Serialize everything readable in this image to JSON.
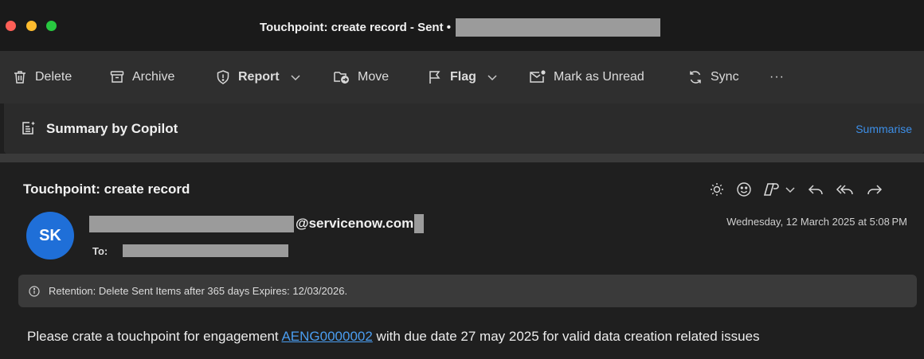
{
  "window": {
    "title": "Touchpoint: create record - Sent •"
  },
  "toolbar": {
    "delete": "Delete",
    "archive": "Archive",
    "report": "Report",
    "move": "Move",
    "flag": "Flag",
    "mark_unread": "Mark as Unread",
    "sync": "Sync",
    "more": "···"
  },
  "copilot": {
    "title": "Summary by Copilot",
    "summarise": "Summarise"
  },
  "message": {
    "subject": "Touchpoint: create record",
    "avatar_initials": "SK",
    "sender_domain": "@servicenow.com",
    "to_label": "To:",
    "date": "Wednesday, 12 March 2025 at 5:08 PM",
    "retention": "Retention: Delete Sent Items after 365 days Expires: 12/03/2026.",
    "body_before": "Please crate a touchpoint for engagement ",
    "body_link": "AENG0000002",
    "body_after": " with due date 27 may 2025 for valid data creation related issues"
  },
  "icons": {
    "delete": "trash-icon",
    "archive": "archive-box-icon",
    "report": "shield-icon",
    "move": "move-folder-icon",
    "flag": "flag-icon",
    "mark_unread": "envelope-dot-icon",
    "sync": "sync-icon",
    "copilot": "copilot-summary-icon",
    "actions": [
      "sun-icon",
      "emoji-icon",
      "loop-icon",
      "reply-icon",
      "reply-all-icon",
      "forward-icon"
    ],
    "retention": "info-icon"
  },
  "colors": {
    "window_bg": "#1f1f1f",
    "toolbar_bg": "#2f2f2f",
    "accent_link": "#4a9df0",
    "avatar": "#1f6fd8",
    "traffic_red": "#fe5f57",
    "traffic_yellow": "#febc2e",
    "traffic_green": "#28c840"
  }
}
